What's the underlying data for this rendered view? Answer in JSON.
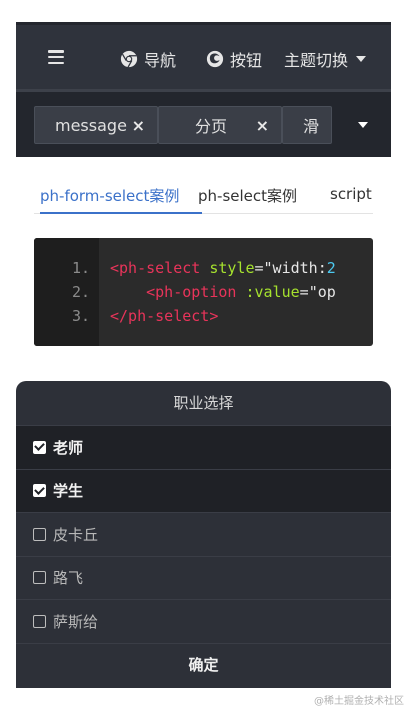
{
  "nav": {
    "items": [
      {
        "label": "导航",
        "icon": "chrome-icon"
      },
      {
        "label": "按钮",
        "icon": "firefox-icon"
      },
      {
        "label": "主题切换",
        "icon": "chevron-down-icon"
      }
    ]
  },
  "tabs": [
    {
      "label": "message",
      "close": "×"
    },
    {
      "label": "分页",
      "close": "×"
    },
    {
      "label": "滑"
    }
  ],
  "subtabs": [
    "ph-form-select案例",
    "ph-select案例",
    "script"
  ],
  "code": {
    "line_numbers": [
      "1.",
      "2.",
      "3."
    ],
    "line1": {
      "tag": "<ph-select",
      "attr": "style",
      "eq": "=",
      "str_a": "\"width:",
      "num": "2"
    },
    "line2": {
      "tag": "<ph-option",
      "attr": ":value",
      "eq": "=",
      "str_a": "\"op"
    },
    "line3": {
      "tag": "</ph-select>"
    }
  },
  "picker": {
    "title": "职业选择",
    "options": [
      {
        "label": "老师",
        "checked": true
      },
      {
        "label": "学生",
        "checked": true
      },
      {
        "label": "皮卡丘",
        "checked": false
      },
      {
        "label": "路飞",
        "checked": false
      },
      {
        "label": "萨斯给",
        "checked": false
      }
    ],
    "confirm": "确定"
  },
  "watermark": "@稀土掘金技术社区",
  "colors": {
    "nav_bg": "#2f333c",
    "tabbar_bg": "#23262d",
    "accent": "#3b71c9",
    "picker_bg": "#2d3038",
    "checked_bg": "#1f2126"
  }
}
